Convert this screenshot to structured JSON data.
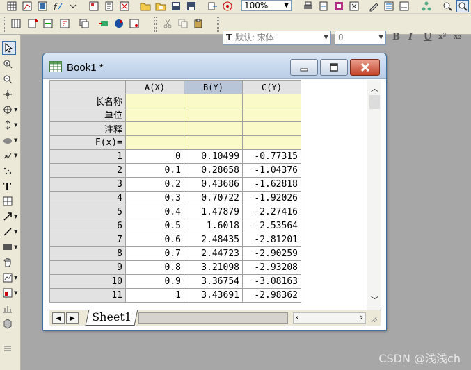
{
  "toolbar": {
    "zoom_value": "100%",
    "font_name": "默认: 宋体",
    "font_size": "0",
    "format_buttons": [
      "B",
      "I",
      "U",
      "x²",
      "x₂"
    ]
  },
  "window": {
    "title": "Book1 *"
  },
  "sheet": {
    "columns": [
      "A(X)",
      "B(Y)",
      "C(Y)"
    ],
    "meta_rows": [
      "长名称",
      "单位",
      "注释",
      "F(x)="
    ],
    "rows": [
      {
        "n": "1",
        "a": "0",
        "b": "0.10499",
        "c": "-0.77315"
      },
      {
        "n": "2",
        "a": "0.1",
        "b": "0.28658",
        "c": "-1.04376"
      },
      {
        "n": "3",
        "a": "0.2",
        "b": "0.43686",
        "c": "-1.62818"
      },
      {
        "n": "4",
        "a": "0.3",
        "b": "0.70722",
        "c": "-1.92026"
      },
      {
        "n": "5",
        "a": "0.4",
        "b": "1.47879",
        "c": "-2.27416"
      },
      {
        "n": "6",
        "a": "0.5",
        "b": "1.6018",
        "c": "-2.53564"
      },
      {
        "n": "7",
        "a": "0.6",
        "b": "2.48435",
        "c": "-2.81201"
      },
      {
        "n": "8",
        "a": "0.7",
        "b": "2.44723",
        "c": "-2.90259"
      },
      {
        "n": "9",
        "a": "0.8",
        "b": "3.21098",
        "c": "-2.93208"
      },
      {
        "n": "10",
        "a": "0.9",
        "b": "3.36754",
        "c": "-3.08163"
      },
      {
        "n": "11",
        "a": "1",
        "b": "3.43691",
        "c": "-2.98362"
      }
    ],
    "tab_label": "Sheet1"
  },
  "watermark": "CSDN @浅浅ch",
  "colors": {
    "workspace": "#a7a7a7",
    "meta_row": "#fafac8",
    "header": "#e2e2e2",
    "selected_header": "#b8c4d8",
    "title_gradient_top": "#d9e6f5",
    "close_button": "#c4432a"
  }
}
